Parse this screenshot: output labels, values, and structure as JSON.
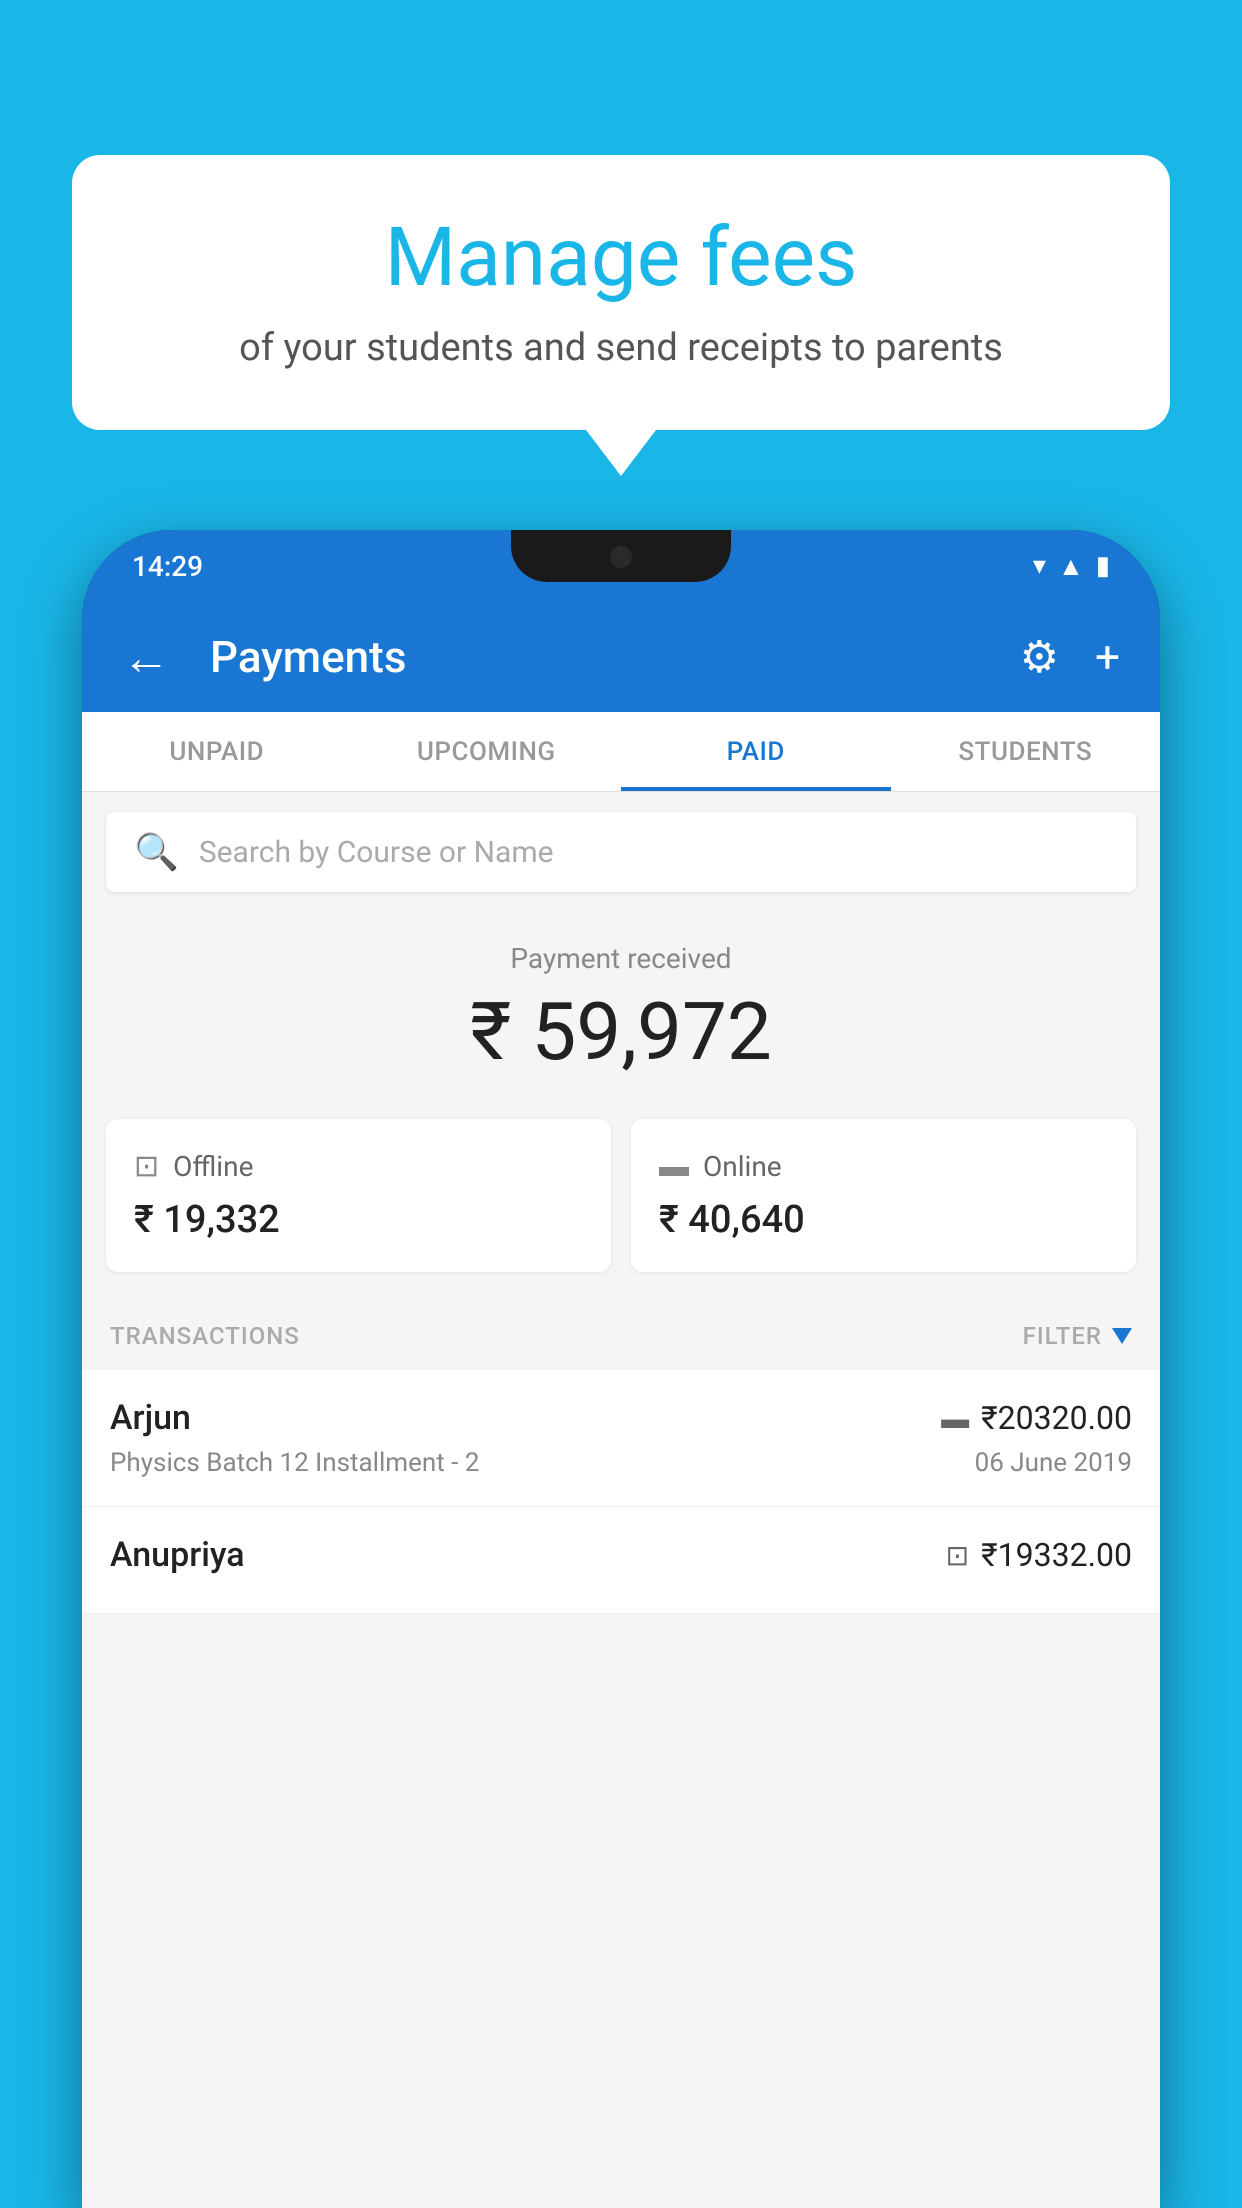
{
  "background_color": "#1ab6e8",
  "speech_bubble": {
    "title": "Manage fees",
    "subtitle": "of your students and send receipts to parents"
  },
  "status_bar": {
    "time": "14:29",
    "icons": [
      "wifi",
      "signal",
      "battery"
    ]
  },
  "app_bar": {
    "title": "Payments",
    "back_label": "←",
    "gear_label": "⚙",
    "plus_label": "+"
  },
  "tabs": [
    {
      "label": "UNPAID",
      "active": false
    },
    {
      "label": "UPCOMING",
      "active": false
    },
    {
      "label": "PAID",
      "active": true
    },
    {
      "label": "STUDENTS",
      "active": false
    }
  ],
  "search": {
    "placeholder": "Search by Course or Name"
  },
  "payment_received": {
    "label": "Payment received",
    "amount": "₹ 59,972"
  },
  "payment_cards": [
    {
      "icon": "cash",
      "label": "Offline",
      "amount": "₹ 19,332"
    },
    {
      "icon": "card",
      "label": "Online",
      "amount": "₹ 40,640"
    }
  ],
  "transactions_section": {
    "label": "TRANSACTIONS",
    "filter_label": "FILTER"
  },
  "transactions": [
    {
      "name": "Arjun",
      "amount": "₹20320.00",
      "payment_type": "card",
      "course": "Physics Batch 12 Installment - 2",
      "date": "06 June 2019"
    },
    {
      "name": "Anupriya",
      "amount": "₹19332.00",
      "payment_type": "cash",
      "course": "",
      "date": ""
    }
  ]
}
